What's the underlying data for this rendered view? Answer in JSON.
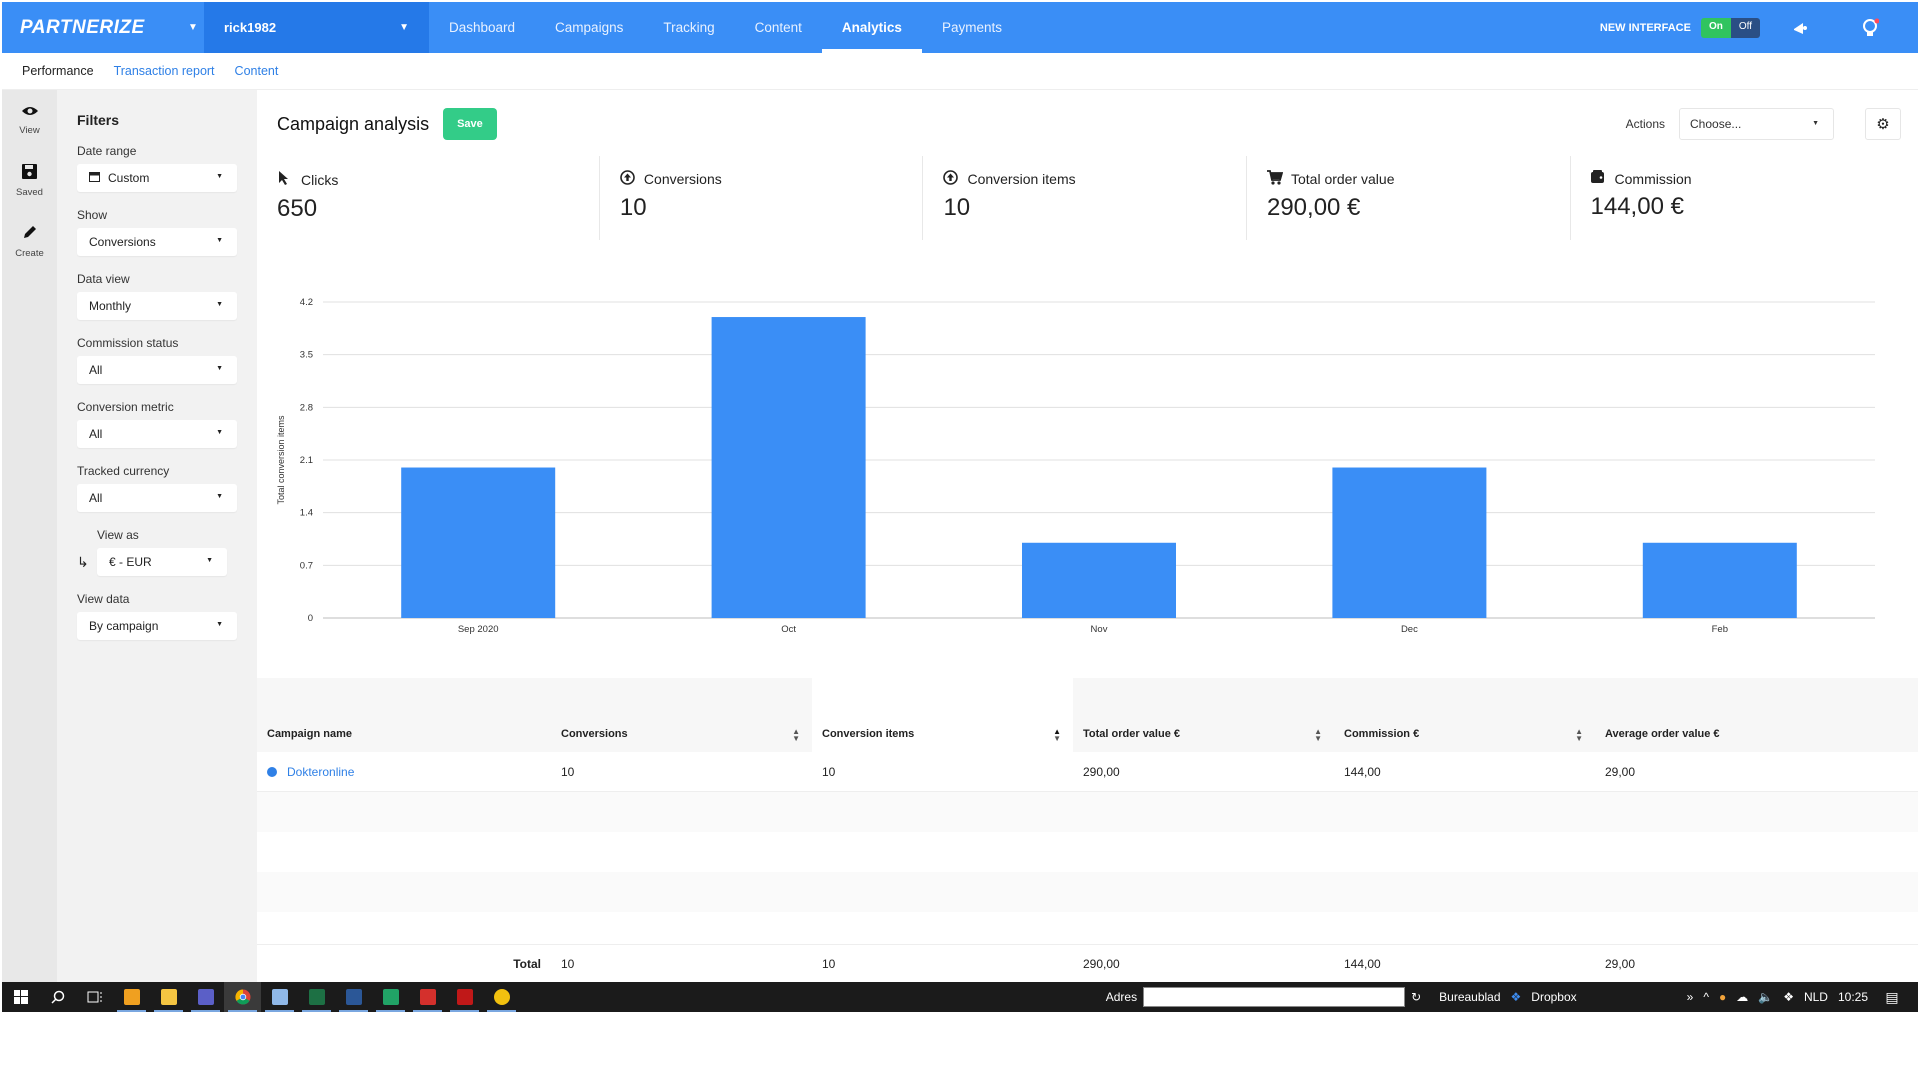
{
  "brand": "PARTNERIZE",
  "account": "rick1982",
  "nav": {
    "items": [
      "Dashboard",
      "Campaigns",
      "Tracking",
      "Content",
      "Analytics",
      "Payments"
    ],
    "active": "Analytics"
  },
  "topright": {
    "new_interface": "NEW INTERFACE",
    "on": "On",
    "off": "Off"
  },
  "subnav": {
    "current": "Performance",
    "links": [
      "Transaction report",
      "Content"
    ]
  },
  "rail": [
    {
      "label": "View",
      "icon": "eye-icon"
    },
    {
      "label": "Saved",
      "icon": "floppy-icon"
    },
    {
      "label": "Create",
      "icon": "pencil-icon"
    }
  ],
  "filters": {
    "title": "Filters",
    "date_range": {
      "label": "Date range",
      "value": "Custom"
    },
    "show": {
      "label": "Show",
      "value": "Conversions"
    },
    "data_view": {
      "label": "Data view",
      "value": "Monthly"
    },
    "commission_status": {
      "label": "Commission status",
      "value": "All"
    },
    "conversion_metric": {
      "label": "Conversion metric",
      "value": "All"
    },
    "tracked_currency": {
      "label": "Tracked currency",
      "value": "All"
    },
    "view_as": {
      "label": "View as",
      "value": "€ - EUR"
    },
    "view_data": {
      "label": "View data",
      "value": "By campaign"
    }
  },
  "main": {
    "title": "Campaign analysis",
    "save": "Save",
    "actions_label": "Actions",
    "actions_select": "Choose..."
  },
  "kpis": [
    {
      "label": "Clicks",
      "value": "650",
      "icon": "cursor-icon"
    },
    {
      "label": "Conversions",
      "value": "10",
      "icon": "arrow-up-circle-icon"
    },
    {
      "label": "Conversion items",
      "value": "10",
      "icon": "arrow-up-circle-icon"
    },
    {
      "label": "Total order value",
      "value": "290,00 €",
      "icon": "cart-icon"
    },
    {
      "label": "Commission",
      "value": "144,00 €",
      "icon": "wallet-icon"
    }
  ],
  "chart_data": {
    "type": "bar",
    "categories": [
      "Sep 2020",
      "Oct",
      "Nov",
      "Dec",
      "Feb"
    ],
    "values": [
      2,
      4,
      1,
      2,
      1
    ],
    "ylabel": "Total conversion items",
    "yticks": [
      "0",
      "0.7",
      "1.4",
      "2.1",
      "2.8",
      "3.5",
      "4.2"
    ],
    "ylim": [
      0,
      4.2
    ],
    "color": "#3a8ef6",
    "grid": true
  },
  "table": {
    "headers": [
      "Campaign name",
      "Conversions",
      "Conversion items",
      "Total order value €",
      "Commission €",
      "Average order value €"
    ],
    "rows": [
      [
        "Dokteronline",
        "10",
        "10",
        "290,00",
        "144,00",
        "29,00"
      ]
    ],
    "total": {
      "label": "Total",
      "values": [
        "10",
        "10",
        "290,00",
        "144,00",
        "29,00"
      ]
    }
  },
  "taskbar": {
    "address_label": "Adres",
    "desktop": "Bureaublad",
    "dropbox": "Dropbox",
    "lang": "NLD",
    "time": "10:25"
  }
}
